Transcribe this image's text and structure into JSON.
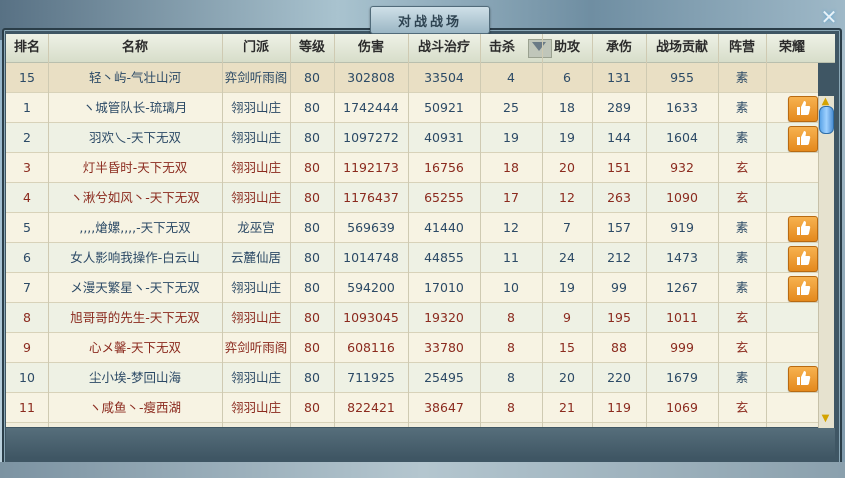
{
  "title": "对战战场",
  "columns": [
    "排名",
    "名称",
    "门派",
    "等级",
    "伤害",
    "战斗治疗",
    "击杀",
    "助攻",
    "承伤",
    "战场贡献",
    "阵营",
    "荣耀"
  ],
  "self_row": {
    "rank": "15",
    "name": "轻丶屿-气壮山河",
    "sect": "弈剑听雨阁",
    "level": "80",
    "damage": "302808",
    "heal": "33504",
    "kills": "4",
    "assists": "6",
    "taken": "131",
    "contribution": "955",
    "camp": "素",
    "glory": false
  },
  "rows": [
    {
      "rank": "1",
      "name": "ヽ城管队长-琉璃月",
      "sect": "翎羽山庄",
      "level": "80",
      "damage": "1742444",
      "heal": "50921",
      "kills": "25",
      "assists": "18",
      "taken": "289",
      "contribution": "1633",
      "camp": "素",
      "glory": true
    },
    {
      "rank": "2",
      "name": "羽欢乀-天下无双",
      "sect": "翎羽山庄",
      "level": "80",
      "damage": "1097272",
      "heal": "40931",
      "kills": "19",
      "assists": "19",
      "taken": "144",
      "contribution": "1604",
      "camp": "素",
      "glory": true
    },
    {
      "rank": "3",
      "name": "灯半昏时-天下无双",
      "sect": "翎羽山庄",
      "level": "80",
      "damage": "1192173",
      "heal": "16756",
      "kills": "18",
      "assists": "20",
      "taken": "151",
      "contribution": "932",
      "camp": "玄",
      "glory": false
    },
    {
      "rank": "4",
      "name": "ヽ湫兮如风丶-天下无双",
      "sect": "翎羽山庄",
      "level": "80",
      "damage": "1176437",
      "heal": "65255",
      "kills": "17",
      "assists": "12",
      "taken": "263",
      "contribution": "1090",
      "camp": "玄",
      "glory": false
    },
    {
      "rank": "5",
      "name": ",,,,熗嫘,,,,-天下无双",
      "sect": "龙巫宫",
      "level": "80",
      "damage": "569639",
      "heal": "41440",
      "kills": "12",
      "assists": "7",
      "taken": "157",
      "contribution": "919",
      "camp": "素",
      "glory": true
    },
    {
      "rank": "6",
      "name": "女人影响我操作-白云山",
      "sect": "云麓仙居",
      "level": "80",
      "damage": "1014748",
      "heal": "44855",
      "kills": "11",
      "assists": "24",
      "taken": "212",
      "contribution": "1473",
      "camp": "素",
      "glory": true
    },
    {
      "rank": "7",
      "name": "メ漫天繁星ヽ-天下无双",
      "sect": "翎羽山庄",
      "level": "80",
      "damage": "594200",
      "heal": "17010",
      "kills": "10",
      "assists": "19",
      "taken": "99",
      "contribution": "1267",
      "camp": "素",
      "glory": true
    },
    {
      "rank": "8",
      "name": "旭哥哥的先生-天下无双",
      "sect": "翎羽山庄",
      "level": "80",
      "damage": "1093045",
      "heal": "19320",
      "kills": "8",
      "assists": "9",
      "taken": "195",
      "contribution": "1011",
      "camp": "玄",
      "glory": false
    },
    {
      "rank": "9",
      "name": "心メ馨-天下无双",
      "sect": "弈剑听雨阁",
      "level": "80",
      "damage": "608116",
      "heal": "33780",
      "kills": "8",
      "assists": "15",
      "taken": "88",
      "contribution": "999",
      "camp": "玄",
      "glory": false
    },
    {
      "rank": "10",
      "name": "尘小埃-梦回山海",
      "sect": "翎羽山庄",
      "level": "80",
      "damage": "711925",
      "heal": "25495",
      "kills": "8",
      "assists": "20",
      "taken": "220",
      "contribution": "1679",
      "camp": "素",
      "glory": true
    },
    {
      "rank": "11",
      "name": "ヽ咸鱼丶-瘦西湖",
      "sect": "翎羽山庄",
      "level": "80",
      "damage": "822421",
      "heal": "38647",
      "kills": "8",
      "assists": "21",
      "taken": "119",
      "contribution": "1069",
      "camp": "玄",
      "glory": false
    }
  ],
  "icons": {
    "close": "close-icon",
    "sort": "sort-desc-icon",
    "thumb": "thumbs-up-icon",
    "scroll_up": "scroll-up-icon",
    "scroll_down": "scroll-down-icon"
  },
  "colors": {
    "su": "#2c4a66",
    "xuan": "#8b2a1e",
    "thumb": "#e4891d"
  }
}
